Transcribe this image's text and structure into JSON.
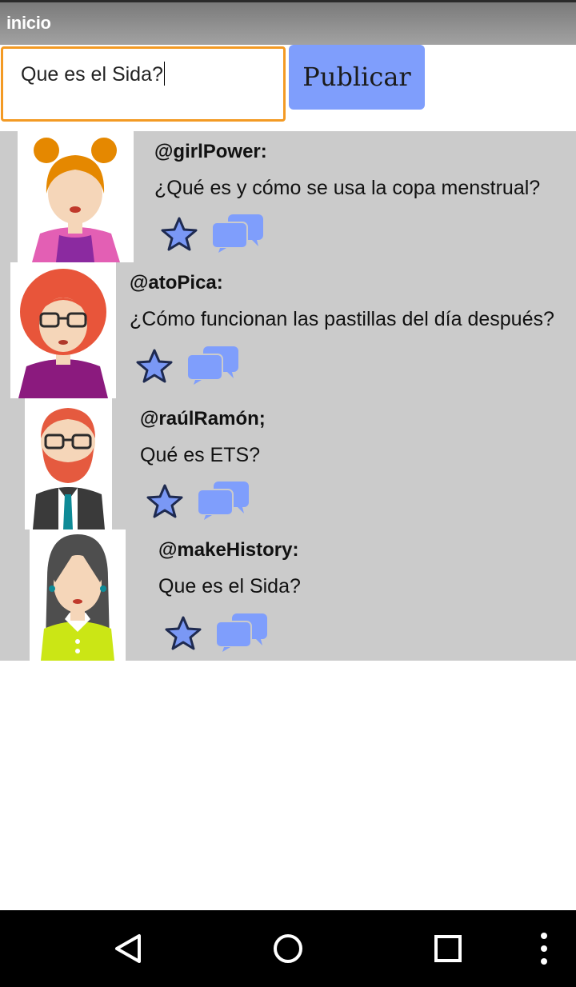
{
  "app": {
    "title": "inicio"
  },
  "composer": {
    "value": "Que es el Sida?",
    "publish_label": "Publicar"
  },
  "posts": [
    {
      "user": "@girlPower:",
      "question": "¿Qué es y cómo se usa la copa menstrual?"
    },
    {
      "user": "@atoPica:",
      "question": "¿Cómo funcionan las pastillas del día después?"
    },
    {
      "user": "@raúlRamón;",
      "question": "Qué es ETS?"
    },
    {
      "user": "@makeHistory:",
      "question": "Que es el Sida?"
    }
  ],
  "icons": {
    "star": "star-icon",
    "comment": "comment-bubbles-icon",
    "back": "back-icon",
    "home": "home-icon",
    "recents": "recents-icon",
    "more": "more-vert-icon"
  },
  "colors": {
    "accent": "#7f9efc",
    "input_border": "#f39a24",
    "feed_bg": "#cbcbcb",
    "title_bar": "#8e8e8e"
  }
}
